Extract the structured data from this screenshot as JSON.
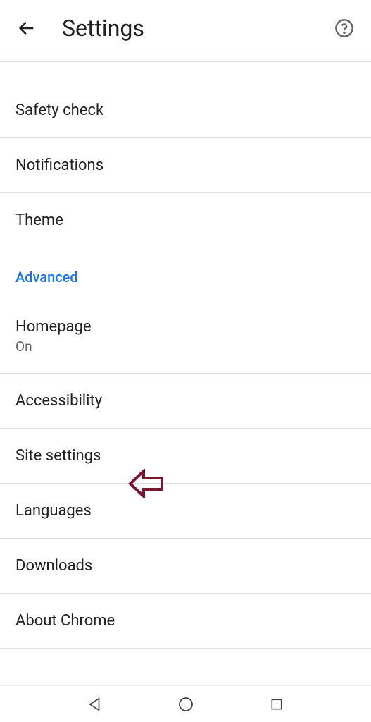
{
  "header": {
    "title": "Settings"
  },
  "items": {
    "safety_check": "Safety check",
    "notifications": "Notifications",
    "theme": "Theme",
    "homepage": "Homepage",
    "homepage_status": "On",
    "accessibility": "Accessibility",
    "site_settings": "Site settings",
    "languages": "Languages",
    "downloads": "Downloads",
    "about_chrome": "About Chrome"
  },
  "section": {
    "advanced": "Advanced"
  }
}
